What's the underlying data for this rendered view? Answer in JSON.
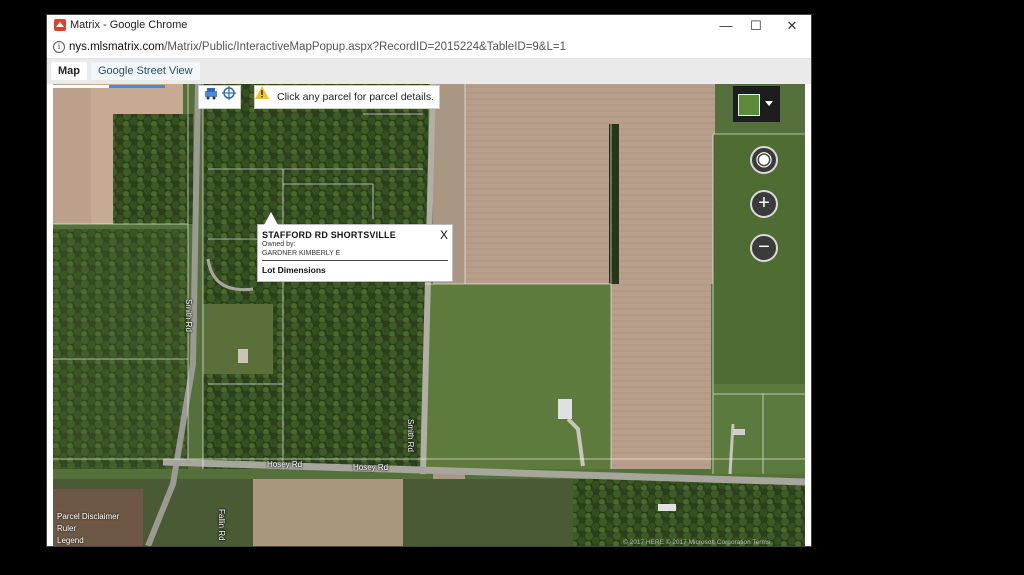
{
  "window": {
    "title": "Matrix - Google Chrome",
    "minimize": "—",
    "maximize": "☐",
    "close": "✕"
  },
  "address": {
    "host": "nys.mlsmatrix.com",
    "path": "/Matrix/Public/InteractiveMapPopup.aspx?RecordID=2015224&TableID=9&L=1"
  },
  "tabs": [
    "Map",
    "Google Street View"
  ],
  "map": {
    "hint": "Click any parcel for parcel details.",
    "controls": {
      "locate": "◉",
      "zoom_in": "+",
      "zoom_out": "−"
    },
    "road_labels": [
      "Hosey Rd",
      "Hosey Rd",
      "Smith Rd",
      "Smith Rd",
      "Fallin Rd"
    ],
    "parcel_popup": {
      "title": "STAFFORD RD SHORTSVILLE",
      "close": "X",
      "owned_by_label": "Owned by:",
      "owner": "GARDNER KIMBERLY E",
      "lot_dimensions_link": "Lot Dimensions"
    },
    "legal_links": [
      "Parcel Disclaimer",
      "Ruler",
      "Legend"
    ],
    "copyright": "© 2017 HERE  © 2017 Microsoft Corporation  Terms",
    "colors": {
      "warning": "#f3c419",
      "tab_link": "#2a4c6b",
      "map_control": "#3b3b3b"
    }
  }
}
